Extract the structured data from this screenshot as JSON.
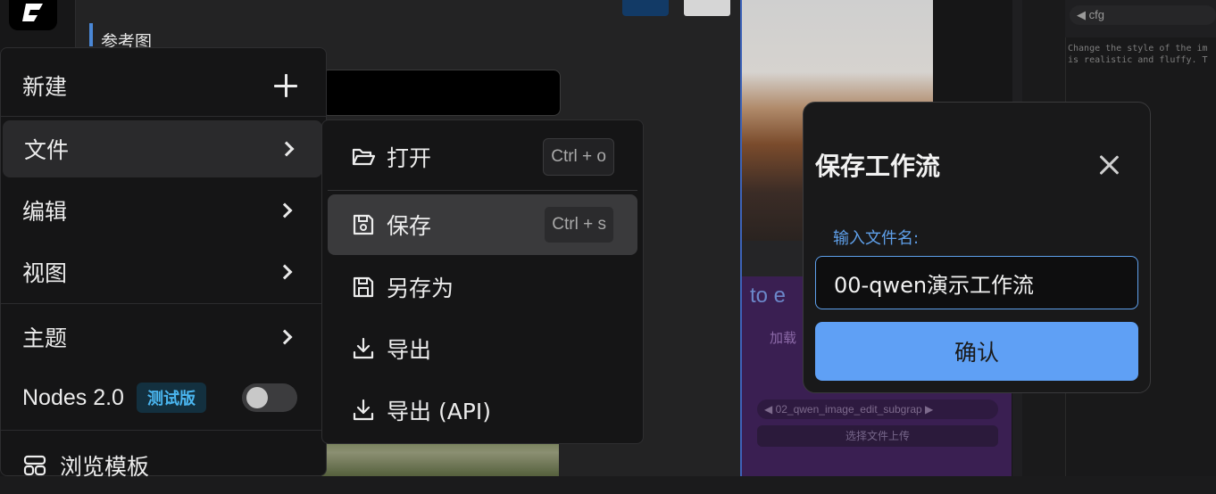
{
  "background": {
    "reference_title": "参考图",
    "canvas_text_fragment": "to e",
    "canvas_small_text": "加载",
    "combo_value": "02_qwen_image_edit_subgrap",
    "upload_label": "选择文件上传",
    "cfg_label": "cfg",
    "prompt_snippet": "Change the style of the im\nis realistic and fluffy. T"
  },
  "menu": {
    "new": "新建",
    "file": "文件",
    "edit": "编辑",
    "view": "视图",
    "theme": "主题",
    "nodes_label": "Nodes 2.0",
    "nodes_badge": "测试版",
    "nodes_enabled": false,
    "browse_templates": "浏览模板"
  },
  "file_submenu": {
    "open": "打开",
    "open_shortcut": "Ctrl + o",
    "save": "保存",
    "save_shortcut": "Ctrl + s",
    "save_as": "另存为",
    "export": "导出",
    "export_api": "导出 (API)"
  },
  "save_dialog": {
    "title": "保存工作流",
    "label": "输入文件名:",
    "filename": "00-qwen演示工作流",
    "confirm": "确认"
  },
  "colors": {
    "accent": "#5fa0f5",
    "badge_text": "#4ab6f0",
    "badge_bg": "#13303f"
  }
}
